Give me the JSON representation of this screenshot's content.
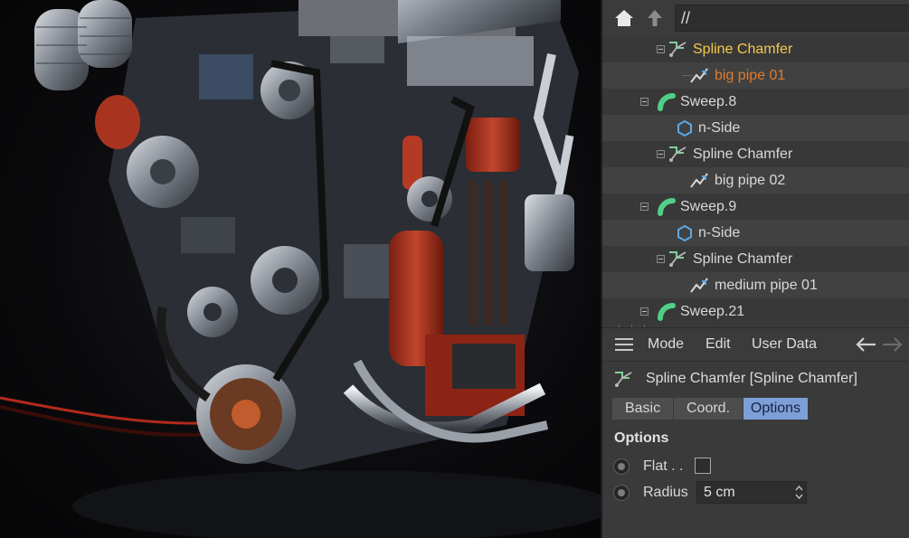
{
  "path_bar": {
    "path": "//",
    "home_icon": "home-icon",
    "up_icon": "arrow-up-icon"
  },
  "tree": {
    "rows": [
      {
        "label": "Spline Chamfer",
        "icon": "spline-chamfer-icon",
        "state": "active"
      },
      {
        "label": "big pipe 01",
        "icon": "spline-icon",
        "state": "child-active"
      },
      {
        "label": "Sweep.8",
        "icon": "sweep-icon",
        "state": "normal"
      },
      {
        "label": "n-Side",
        "icon": "n-side-icon",
        "state": "normal"
      },
      {
        "label": "Spline Chamfer",
        "icon": "spline-chamfer-icon",
        "state": "normal"
      },
      {
        "label": "big pipe 02",
        "icon": "spline-icon",
        "state": "normal"
      },
      {
        "label": "Sweep.9",
        "icon": "sweep-icon",
        "state": "normal"
      },
      {
        "label": "n-Side",
        "icon": "n-side-icon",
        "state": "normal"
      },
      {
        "label": "Spline Chamfer",
        "icon": "spline-chamfer-icon",
        "state": "normal"
      },
      {
        "label": "medium pipe 01",
        "icon": "spline-icon",
        "state": "normal"
      },
      {
        "label": "Sweep.21",
        "icon": "sweep-icon",
        "state": "normal"
      }
    ]
  },
  "attributes": {
    "menu": {
      "mode": "Mode",
      "edit": "Edit",
      "user_data": "User Data"
    },
    "title": "Spline Chamfer [Spline Chamfer]",
    "tabs": [
      "Basic",
      "Coord.",
      "Options"
    ],
    "selected_tab": "Options",
    "section": "Options",
    "params": {
      "flat_label": "Flat . .",
      "flat_checked": false,
      "radius_label": "Radius",
      "radius_value": "5 cm"
    }
  },
  "colors": {
    "active_label": "#f3c94c",
    "child_active_label": "#e07b2a",
    "selected_tab": "#7d9fd8"
  }
}
